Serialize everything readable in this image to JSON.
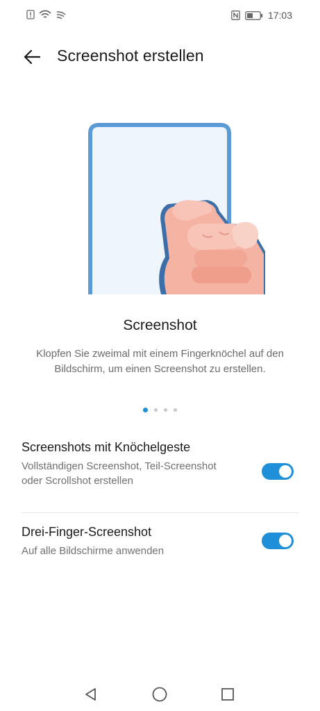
{
  "status_bar": {
    "time": "17:03",
    "left_icons": [
      "alert-sim-icon",
      "wifi-icon",
      "hotspot-icon"
    ],
    "right_icons": [
      "nfc-icon",
      "battery-icon"
    ]
  },
  "header": {
    "title": "Screenshot erstellen",
    "back_icon": "arrow-left-icon"
  },
  "illustration": {
    "icon": "knuckle-tap-phone-illustration",
    "frame_color": "#5b9bd5"
  },
  "carousel": {
    "title": "Screenshot",
    "description": "Klopfen Sie zweimal mit einem Fingerknöchel auf den Bildschirm, um einen Screenshot zu erstellen.",
    "page_count": 4,
    "active_page": 1
  },
  "settings": [
    {
      "title": "Screenshots mit Knöchelgeste",
      "subtitle": "Vollständigen Screenshot, Teil-Screenshot oder Scrollshot erstellen",
      "enabled": true
    },
    {
      "title": "Drei-Finger-Screenshot",
      "subtitle": "Auf alle Bildschirme anwenden",
      "enabled": true
    }
  ],
  "navigation": {
    "buttons": [
      "back-triangle-icon",
      "home-circle-icon",
      "recents-square-icon"
    ]
  },
  "colors": {
    "accent": "#1e8fd8",
    "text_primary": "#1a1a1a",
    "text_secondary": "#6b6b6b",
    "background": "#ffffff"
  }
}
